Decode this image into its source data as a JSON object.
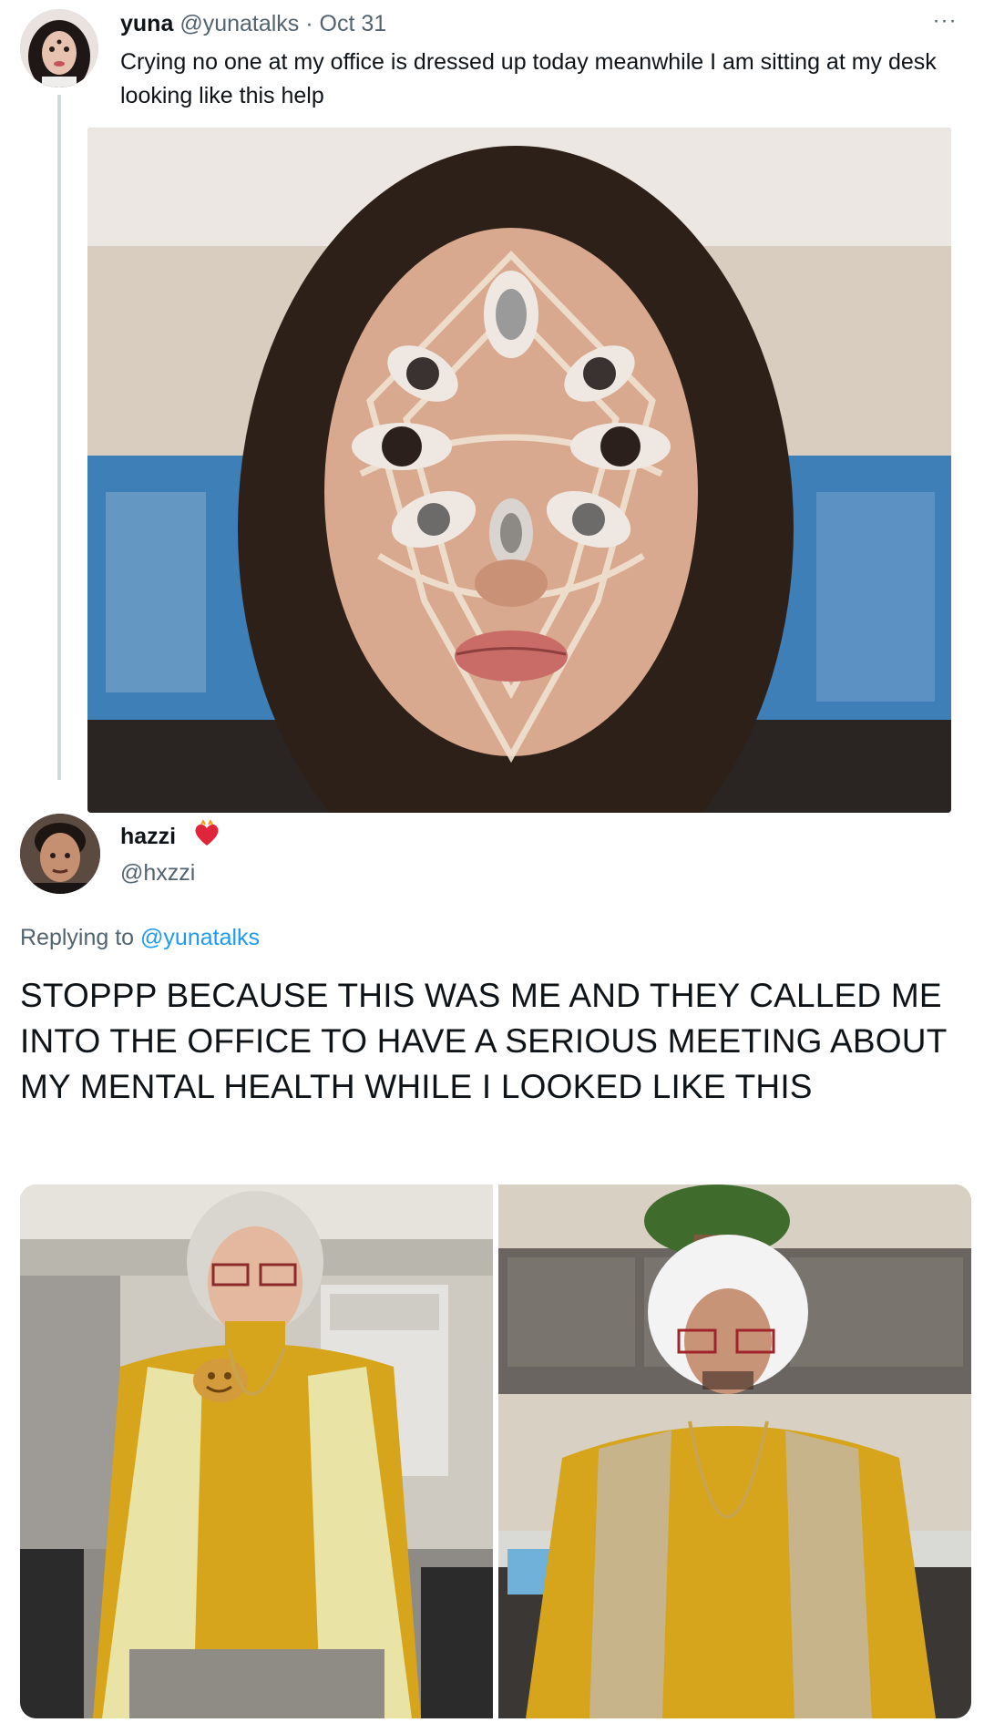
{
  "tweet1": {
    "avatar_icon": "user-avatar-icon",
    "display_name": "yuna",
    "handle": "@yunatalks",
    "separator": "·",
    "date": "Oct 31",
    "more_icon": "more-horizontal-icon",
    "more_label": "···",
    "text": "Crying no one at my office is dressed up today meanwhile I am sitting at my desk looking like this help"
  },
  "tweet2": {
    "avatar_icon": "user-avatar-icon",
    "display_name": "hazzi",
    "badge_icon": "red-heart-emoji-icon",
    "handle": "@hxzzi",
    "replying_prefix": "Replying to",
    "replying_mention": "@yunatalks",
    "text": "STOPPP BECAUSE THIS WAS ME AND THEY CALLED ME INTO THE OFFICE TO HAVE A SERIOUS MEETING ABOUT MY MENTAL HEALTH WHILE I LOOKED LIKE THIS"
  },
  "colors": {
    "text_primary": "#0f1419",
    "text_secondary": "#536471",
    "link": "#1d9bf0",
    "thread_line": "#cfd9de",
    "sweater_mustard": "#d6a51c"
  }
}
